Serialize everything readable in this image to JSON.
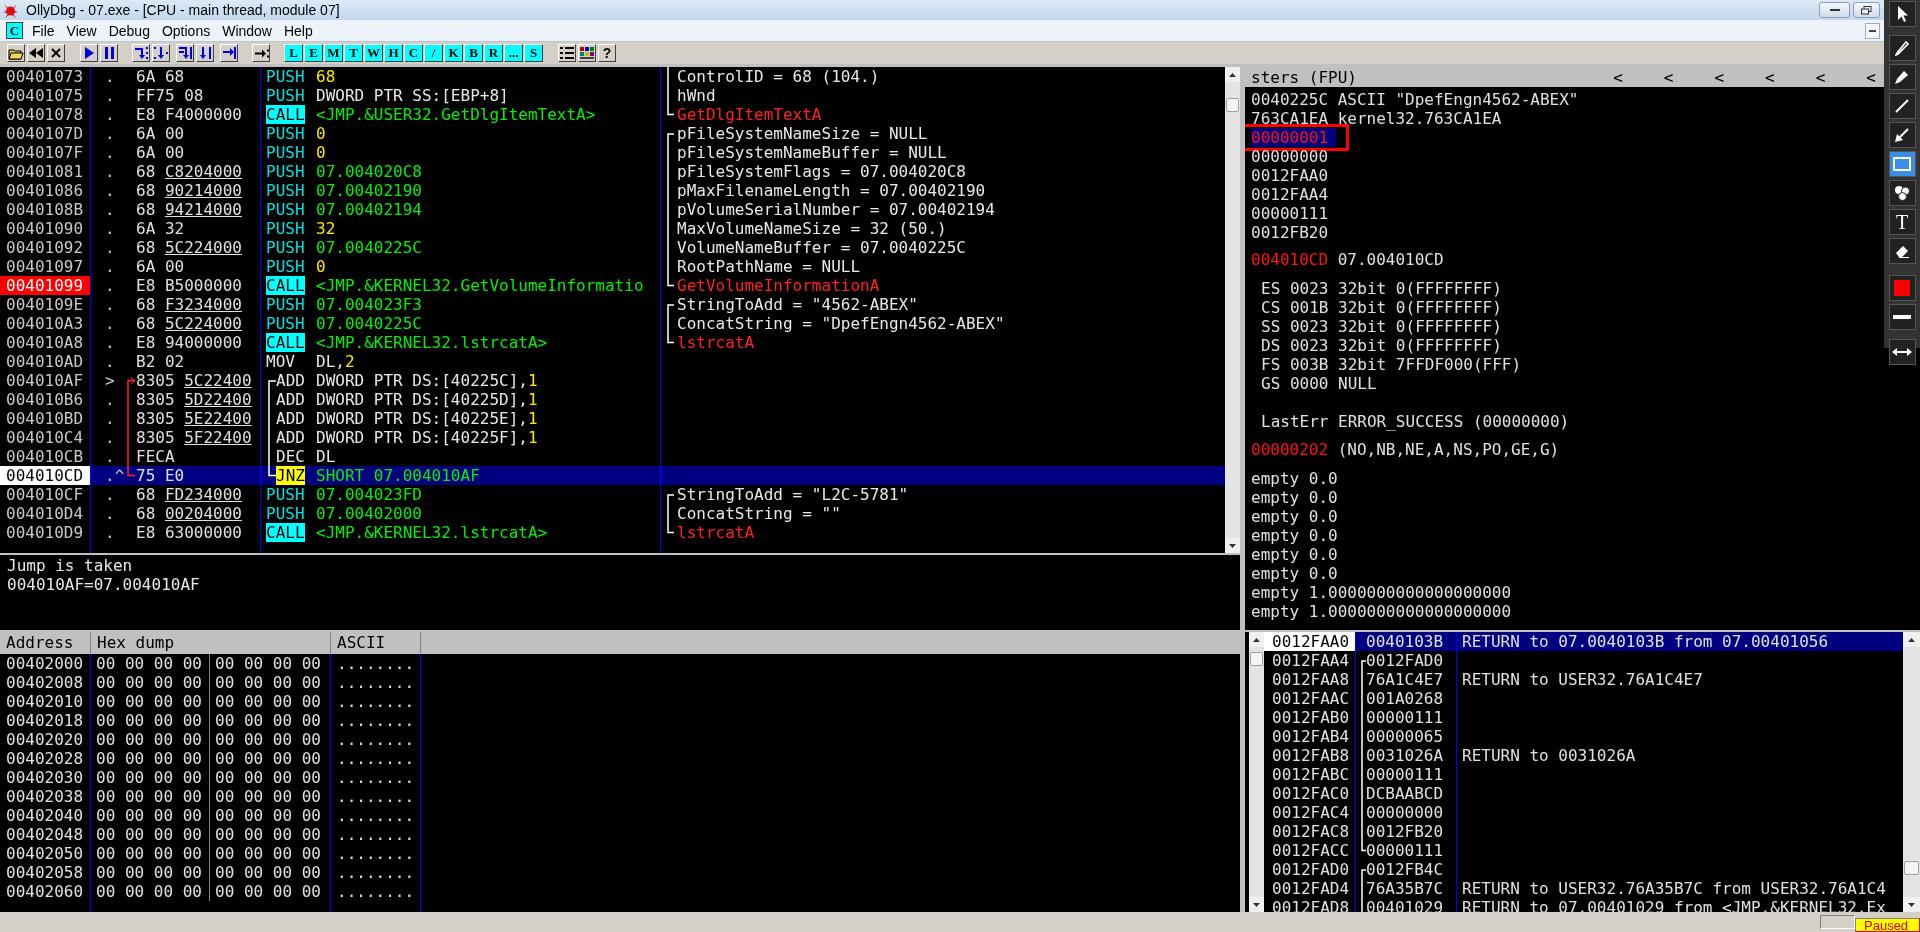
{
  "window": {
    "title": "OllyDbg - 07.exe - [CPU - main thread, module 07]"
  },
  "menu": {
    "icon_letter": "C",
    "items": [
      "File",
      "View",
      "Debug",
      "Options",
      "Window",
      "Help"
    ]
  },
  "toolbar": {
    "letters": [
      "L",
      "E",
      "M",
      "T",
      "W",
      "H",
      "C",
      "/",
      "K",
      "B",
      "R",
      "...",
      "S"
    ],
    "help": "?"
  },
  "disassembly": {
    "rows": [
      {
        "address": "00401073",
        "breakpoint": false,
        "eip": false,
        "marker": ".",
        "bytes": "6A 68",
        "mnemonic": {
          "text": "PUSH",
          "kind": "push"
        },
        "operands": [
          {
            "text": "68",
            "kind": "const"
          }
        ],
        "comment": {
          "text": "ControlID = 68 (104.)",
          "kind": "plain"
        },
        "bracket": {
          "kind": "mid"
        },
        "selected": false
      },
      {
        "address": "00401075",
        "breakpoint": false,
        "eip": false,
        "marker": ".",
        "bytes": "FF75 08",
        "mnemonic": {
          "text": "PUSH",
          "kind": "push"
        },
        "operands": [
          {
            "text": "DWORD PTR SS:[EBP+8]",
            "kind": "plain"
          }
        ],
        "comment": {
          "text": "hWnd",
          "kind": "plain"
        },
        "bracket": {
          "kind": "mid"
        },
        "selected": false
      },
      {
        "address": "00401078",
        "breakpoint": false,
        "eip": false,
        "marker": ".",
        "bytes": "E8 F4000000",
        "mnemonic": {
          "text": "CALL",
          "kind": "call"
        },
        "operands": [
          {
            "text": "<JMP.&USER32.GetDlgItemTextA>",
            "kind": "addr"
          }
        ],
        "comment": {
          "text": "GetDlgItemTextA",
          "kind": "api"
        },
        "bracket": {
          "kind": "end"
        },
        "selected": false
      },
      {
        "address": "0040107D",
        "breakpoint": false,
        "eip": false,
        "marker": ".",
        "bytes": "6A 00",
        "mnemonic": {
          "text": "PUSH",
          "kind": "push"
        },
        "operands": [
          {
            "text": "0",
            "kind": "const"
          }
        ],
        "comment": {
          "text": "pFileSystemNameSize = NULL",
          "kind": "plain"
        },
        "bracket": {
          "kind": "start"
        },
        "selected": false
      },
      {
        "address": "0040107F",
        "breakpoint": false,
        "eip": false,
        "marker": ".",
        "bytes": "6A 00",
        "mnemonic": {
          "text": "PUSH",
          "kind": "push"
        },
        "operands": [
          {
            "text": "0",
            "kind": "const"
          }
        ],
        "comment": {
          "text": "pFileSystemNameBuffer = NULL",
          "kind": "plain"
        },
        "bracket": {
          "kind": "mid"
        },
        "selected": false
      },
      {
        "address": "00401081",
        "breakpoint": false,
        "eip": false,
        "marker": ".",
        "bytes": "68",
        "fixup": "C8204000",
        "mnemonic": {
          "text": "PUSH",
          "kind": "push"
        },
        "operands": [
          {
            "text": "07.004020C8",
            "kind": "addr"
          }
        ],
        "comment": {
          "text": "pFileSystemFlags = 07.004020C8",
          "kind": "plain"
        },
        "bracket": {
          "kind": "mid"
        },
        "selected": false
      },
      {
        "address": "00401086",
        "breakpoint": false,
        "eip": false,
        "marker": ".",
        "bytes": "68",
        "fixup": "90214000",
        "mnemonic": {
          "text": "PUSH",
          "kind": "push"
        },
        "operands": [
          {
            "text": "07.00402190",
            "kind": "addr"
          }
        ],
        "comment": {
          "text": "pMaxFilenameLength = 07.00402190",
          "kind": "plain"
        },
        "bracket": {
          "kind": "mid"
        },
        "selected": false
      },
      {
        "address": "0040108B",
        "breakpoint": false,
        "eip": false,
        "marker": ".",
        "bytes": "68",
        "fixup": "94214000",
        "mnemonic": {
          "text": "PUSH",
          "kind": "push"
        },
        "operands": [
          {
            "text": "07.00402194",
            "kind": "addr"
          }
        ],
        "comment": {
          "text": "pVolumeSerialNumber = 07.00402194",
          "kind": "plain"
        },
        "bracket": {
          "kind": "mid"
        },
        "selected": false
      },
      {
        "address": "00401090",
        "breakpoint": false,
        "eip": false,
        "marker": ".",
        "bytes": "6A 32",
        "mnemonic": {
          "text": "PUSH",
          "kind": "push"
        },
        "operands": [
          {
            "text": "32",
            "kind": "const"
          }
        ],
        "comment": {
          "text": "MaxVolumeNameSize = 32 (50.)",
          "kind": "plain"
        },
        "bracket": {
          "kind": "mid"
        },
        "selected": false
      },
      {
        "address": "00401092",
        "breakpoint": false,
        "eip": false,
        "marker": ".",
        "bytes": "68",
        "fixup": "5C224000",
        "mnemonic": {
          "text": "PUSH",
          "kind": "push"
        },
        "operands": [
          {
            "text": "07.0040225C",
            "kind": "addr"
          }
        ],
        "comment": {
          "text": "VolumeNameBuffer = 07.0040225C",
          "kind": "plain"
        },
        "bracket": {
          "kind": "mid"
        },
        "selected": false
      },
      {
        "address": "00401097",
        "breakpoint": false,
        "eip": false,
        "marker": ".",
        "bytes": "6A 00",
        "mnemonic": {
          "text": "PUSH",
          "kind": "push"
        },
        "operands": [
          {
            "text": "0",
            "kind": "const"
          }
        ],
        "comment": {
          "text": "RootPathName = NULL",
          "kind": "plain"
        },
        "bracket": {
          "kind": "mid"
        },
        "selected": false
      },
      {
        "address": "00401099",
        "breakpoint": true,
        "eip": false,
        "marker": ".",
        "bytes": "E8 B5000000",
        "mnemonic": {
          "text": "CALL",
          "kind": "call"
        },
        "operands": [
          {
            "text": "<JMP.&KERNEL32.GetVolumeInformatio",
            "kind": "addr"
          }
        ],
        "comment": {
          "text": "GetVolumeInformationA",
          "kind": "api"
        },
        "bracket": {
          "kind": "end"
        },
        "selected": false
      },
      {
        "address": "0040109E",
        "breakpoint": false,
        "eip": false,
        "marker": ".",
        "bytes": "68",
        "fixup": "F3234000",
        "mnemonic": {
          "text": "PUSH",
          "kind": "push"
        },
        "operands": [
          {
            "text": "07.004023F3",
            "kind": "addr"
          }
        ],
        "comment": {
          "text": "StringToAdd = \"4562-ABEX\"",
          "kind": "plain"
        },
        "bracket": {
          "kind": "start"
        },
        "selected": false
      },
      {
        "address": "004010A3",
        "breakpoint": false,
        "eip": false,
        "marker": ".",
        "bytes": "68",
        "fixup": "5C224000",
        "mnemonic": {
          "text": "PUSH",
          "kind": "push"
        },
        "operands": [
          {
            "text": "07.0040225C",
            "kind": "addr"
          }
        ],
        "comment": {
          "text": "ConcatString = \"DpefEngn4562-ABEX\"",
          "kind": "plain"
        },
        "bracket": {
          "kind": "mid"
        },
        "selected": false
      },
      {
        "address": "004010A8",
        "breakpoint": false,
        "eip": false,
        "marker": ".",
        "bytes": "E8 94000000",
        "mnemonic": {
          "text": "CALL",
          "kind": "call"
        },
        "operands": [
          {
            "text": "<JMP.&KERNEL32.lstrcatA>",
            "kind": "addr"
          }
        ],
        "comment": {
          "text": "lstrcatA",
          "kind": "api"
        },
        "bracket": {
          "kind": "end"
        },
        "selected": false
      },
      {
        "address": "004010AD",
        "breakpoint": false,
        "eip": false,
        "marker": ".",
        "bytes": "B2 02",
        "mnemonic": {
          "text": "MOV",
          "kind": "plain"
        },
        "operands": [
          {
            "text": "DL,",
            "kind": "plain"
          },
          {
            "text": "2",
            "kind": "const"
          }
        ],
        "selected": false
      },
      {
        "address": "004010AF",
        "breakpoint": false,
        "eip": false,
        "marker": ">",
        "bytes": "8305",
        "fixup": "5C22400",
        "loop": {
          "kind": "start"
        },
        "mnemonic": {
          "text": "ADD",
          "kind": "plain"
        },
        "operands": [
          {
            "text": "DWORD PTR DS:[40225C],",
            "kind": "plain"
          },
          {
            "text": "1",
            "kind": "const"
          }
        ],
        "selected": false
      },
      {
        "address": "004010B6",
        "breakpoint": false,
        "eip": false,
        "marker": ".",
        "bytes": "8305",
        "fixup": "5D22400",
        "loop": {
          "kind": "mid"
        },
        "mnemonic": {
          "text": "ADD",
          "kind": "plain"
        },
        "operands": [
          {
            "text": "DWORD PTR DS:[40225D],",
            "kind": "plain"
          },
          {
            "text": "1",
            "kind": "const"
          }
        ],
        "selected": false
      },
      {
        "address": "004010BD",
        "breakpoint": false,
        "eip": false,
        "marker": ".",
        "bytes": "8305",
        "fixup": "5E22400",
        "loop": {
          "kind": "mid"
        },
        "mnemonic": {
          "text": "ADD",
          "kind": "plain"
        },
        "operands": [
          {
            "text": "DWORD PTR DS:[40225E],",
            "kind": "plain"
          },
          {
            "text": "1",
            "kind": "const"
          }
        ],
        "selected": false
      },
      {
        "address": "004010C4",
        "breakpoint": false,
        "eip": false,
        "marker": ".",
        "bytes": "8305",
        "fixup": "5F22400",
        "loop": {
          "kind": "mid"
        },
        "mnemonic": {
          "text": "ADD",
          "kind": "plain"
        },
        "operands": [
          {
            "text": "DWORD PTR DS:[40225F],",
            "kind": "plain"
          },
          {
            "text": "1",
            "kind": "const"
          }
        ],
        "selected": false
      },
      {
        "address": "004010CB",
        "breakpoint": false,
        "eip": false,
        "marker": ".",
        "bytes": "FECA",
        "loop": {
          "kind": "mid"
        },
        "mnemonic": {
          "text": "DEC",
          "kind": "plain"
        },
        "operands": [
          {
            "text": "DL",
            "kind": "plain"
          }
        ],
        "selected": false
      },
      {
        "address": "004010CD",
        "breakpoint": false,
        "eip": true,
        "marker": ".^",
        "bytes": "75 E0",
        "loop": {
          "kind": "end"
        },
        "mnemonic": {
          "text": "JNZ",
          "kind": "jump"
        },
        "operands": [
          {
            "text": "SHORT 07.004010AF",
            "kind": "addr"
          }
        ],
        "selected": true
      },
      {
        "address": "004010CF",
        "breakpoint": false,
        "eip": false,
        "marker": ".",
        "bytes": "68",
        "fixup": "FD234000",
        "mnemonic": {
          "text": "PUSH",
          "kind": "push"
        },
        "operands": [
          {
            "text": "07.004023FD",
            "kind": "addr"
          }
        ],
        "comment": {
          "text": "StringToAdd = \"L2C-5781\"",
          "kind": "plain"
        },
        "bracket": {
          "kind": "start"
        },
        "selected": false
      },
      {
        "address": "004010D4",
        "breakpoint": false,
        "eip": false,
        "marker": ".",
        "bytes": "68",
        "fixup": "00204000",
        "mnemonic": {
          "text": "PUSH",
          "kind": "push"
        },
        "operands": [
          {
            "text": "07.00402000",
            "kind": "addr"
          }
        ],
        "comment": {
          "text": "ConcatString = \"\"",
          "kind": "plain"
        },
        "bracket": {
          "kind": "mid"
        },
        "selected": false
      },
      {
        "address": "004010D9",
        "breakpoint": false,
        "eip": false,
        "marker": ".",
        "bytes": "E8 63000000",
        "mnemonic": {
          "text": "CALL",
          "kind": "call"
        },
        "operands": [
          {
            "text": "<JMP.&KERNEL32.lstrcatA>",
            "kind": "addr"
          }
        ],
        "comment": {
          "text": "lstrcatA",
          "kind": "api"
        },
        "bracket": {
          "kind": "end"
        },
        "selected": false
      }
    ]
  },
  "info": [
    "Jump is taken",
    "004010AF=07.004010AF"
  ],
  "dump": {
    "columns": [
      "Address",
      "Hex dump",
      "ASCII"
    ],
    "rows": [
      {
        "address": "00402000",
        "hex": [
          "00 00 00 00",
          "00 00 00 00"
        ],
        "ascii": "........"
      },
      {
        "address": "00402008",
        "hex": [
          "00 00 00 00",
          "00 00 00 00"
        ],
        "ascii": "........"
      },
      {
        "address": "00402010",
        "hex": [
          "00 00 00 00",
          "00 00 00 00"
        ],
        "ascii": "........"
      },
      {
        "address": "00402018",
        "hex": [
          "00 00 00 00",
          "00 00 00 00"
        ],
        "ascii": "........"
      },
      {
        "address": "00402020",
        "hex": [
          "00 00 00 00",
          "00 00 00 00"
        ],
        "ascii": "........"
      },
      {
        "address": "00402028",
        "hex": [
          "00 00 00 00",
          "00 00 00 00"
        ],
        "ascii": "........"
      },
      {
        "address": "00402030",
        "hex": [
          "00 00 00 00",
          "00 00 00 00"
        ],
        "ascii": "........"
      },
      {
        "address": "00402038",
        "hex": [
          "00 00 00 00",
          "00 00 00 00"
        ],
        "ascii": "........"
      },
      {
        "address": "00402040",
        "hex": [
          "00 00 00 00",
          "00 00 00 00"
        ],
        "ascii": "........"
      },
      {
        "address": "00402048",
        "hex": [
          "00 00 00 00",
          "00 00 00 00"
        ],
        "ascii": "........"
      },
      {
        "address": "00402050",
        "hex": [
          "00 00 00 00",
          "00 00 00 00"
        ],
        "ascii": "........"
      },
      {
        "address": "00402058",
        "hex": [
          "00 00 00 00",
          "00 00 00 00"
        ],
        "ascii": "........"
      },
      {
        "address": "00402060",
        "hex": [
          "00 00 00 00",
          "00 00 00 00"
        ],
        "ascii": "........"
      }
    ]
  },
  "registers": {
    "header": "sters (FPU)",
    "scroll_arrows": [
      "<",
      "<",
      "<",
      "<",
      "<",
      "<"
    ],
    "general": [
      {
        "value": "0040225C",
        "note": "ASCII \"DpefEngn4562-ABEX\"",
        "changed": false,
        "selected": false,
        "annotated": false
      },
      {
        "value": "763CA1EA",
        "note": "kernel32.763CA1EA",
        "changed": false,
        "selected": false,
        "annotated": false
      },
      {
        "value": "00000001",
        "changed": true,
        "selected": true,
        "annotated": true
      },
      {
        "value": "00000000",
        "changed": false,
        "selected": false,
        "annotated": false
      },
      {
        "value": "0012FAA0",
        "changed": false,
        "selected": false,
        "annotated": false
      },
      {
        "value": "0012FAA4",
        "changed": false,
        "selected": false,
        "annotated": false
      },
      {
        "value": "00000111",
        "changed": false,
        "selected": false,
        "annotated": false
      },
      {
        "value": "0012FB20",
        "changed": false,
        "selected": false,
        "annotated": false
      }
    ],
    "eip": {
      "value": "004010CD",
      "note": "07.004010CD",
      "changed": true
    },
    "segments": [
      "ES 0023 32bit 0(FFFFFFFF)",
      "CS 001B 32bit 0(FFFFFFFF)",
      "SS 0023 32bit 0(FFFFFFFF)",
      "DS 0023 32bit 0(FFFFFFFF)",
      "FS 003B 32bit 7FFDF000(FFF)",
      "GS 0000 NULL"
    ],
    "last_error": "LastErr ERROR_SUCCESS (00000000)",
    "flags": {
      "value": "00000202",
      "note": "(NO,NB,NE,A,NS,PO,GE,G)",
      "changed": true
    },
    "fpu": [
      "empty 0.0",
      "empty 0.0",
      "empty 0.0",
      "empty 0.0",
      "empty 0.0",
      "empty 0.0",
      "empty 1.0000000000000000000",
      "empty 1.0000000000000000000"
    ]
  },
  "stack": {
    "rows": [
      {
        "address": "0012FAA0",
        "value": "0040103B",
        "comment": "RETURN to 07.0040103B from 07.00401056",
        "selected": true
      },
      {
        "address": "0012FAA4",
        "value": "0012FAD0",
        "bracket": {
          "kind": "start"
        },
        "selected": false
      },
      {
        "address": "0012FAA8",
        "value": "76A1C4E7",
        "comment": "RETURN to USER32.76A1C4E7",
        "bracket": {
          "kind": "mid"
        },
        "selected": false
      },
      {
        "address": "0012FAAC",
        "value": "001A0268",
        "bracket": {
          "kind": "mid"
        },
        "selected": false
      },
      {
        "address": "0012FAB0",
        "value": "00000111",
        "bracket": {
          "kind": "mid"
        },
        "selected": false
      },
      {
        "address": "0012FAB4",
        "value": "00000065",
        "bracket": {
          "kind": "mid"
        },
        "selected": false
      },
      {
        "address": "0012FAB8",
        "value": "0031026A",
        "comment": "RETURN to 0031026A",
        "bracket": {
          "kind": "mid"
        },
        "selected": false
      },
      {
        "address": "0012FABC",
        "value": "00000111",
        "bracket": {
          "kind": "mid"
        },
        "selected": false
      },
      {
        "address": "0012FAC0",
        "value": "DCBAABCD",
        "bracket": {
          "kind": "mid"
        },
        "selected": false
      },
      {
        "address": "0012FAC4",
        "value": "00000000",
        "bracket": {
          "kind": "mid"
        },
        "selected": false
      },
      {
        "address": "0012FAC8",
        "value": "0012FB20",
        "bracket": {
          "kind": "mid"
        },
        "selected": false
      },
      {
        "address": "0012FACC",
        "value": "00000111",
        "bracket": {
          "kind": "end"
        },
        "selected": false
      },
      {
        "address": "0012FAD0",
        "value": "0012FB4C",
        "bracket": {
          "kind": "start"
        },
        "selected": false
      },
      {
        "address": "0012FAD4",
        "value": "76A35B7C",
        "comment": "RETURN to USER32.76A35B7C from USER32.76A1C4",
        "bracket": {
          "kind": "mid"
        },
        "selected": false
      },
      {
        "address": "0012FAD8",
        "value": "00401029",
        "comment": "RETURN to 07.00401029 from <JMP.&KERNEL32.Ex",
        "bracket": {
          "kind": "mid"
        },
        "selected": false
      }
    ]
  },
  "status_bar": {
    "state": "Paused"
  },
  "annotation_tools": [
    {
      "kind": "pointer",
      "selected": false
    },
    {
      "kind": "pencil",
      "selected": false
    },
    {
      "kind": "marker",
      "selected": false
    },
    {
      "kind": "line",
      "selected": false
    },
    {
      "kind": "arrow",
      "selected": false
    },
    {
      "kind": "rectangle",
      "selected": true
    },
    {
      "kind": "stamp",
      "selected": false
    },
    {
      "kind": "text",
      "label": "T",
      "selected": false
    },
    {
      "kind": "eraser",
      "selected": false
    },
    {
      "kind": "color",
      "color": "#ff0000",
      "selected": false
    },
    {
      "kind": "width",
      "selected": false
    },
    {
      "kind": "expand",
      "selected": false
    }
  ]
}
